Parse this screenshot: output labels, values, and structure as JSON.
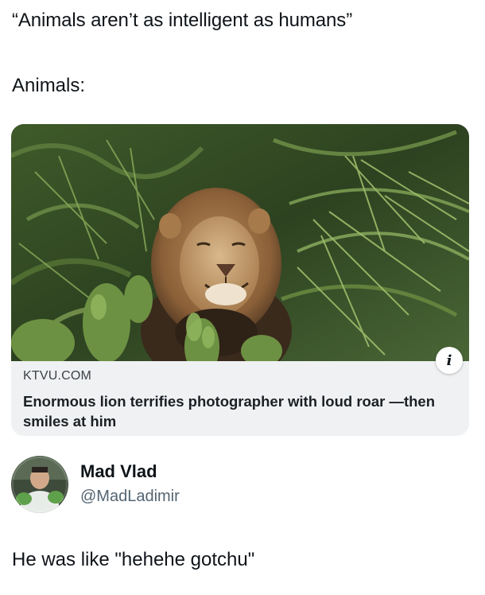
{
  "post": {
    "quote_line": "“Animals aren’t as intelligent as humans”",
    "animals_line": "Animals:"
  },
  "link_card": {
    "image_description_icon": "info-icon",
    "info_glyph": "i",
    "domain": "KTVU.COM",
    "title": "Enormous lion terrifies photographer with loud roar —then smiles at him"
  },
  "author": {
    "name": "Mad Vlad",
    "handle": "@MadLadimir"
  },
  "reply": {
    "text": "He was like \"hehehe gotchu\""
  },
  "colors": {
    "text_primary": "#0f1419",
    "text_secondary": "#536471",
    "card_background": "#eff1f3"
  }
}
